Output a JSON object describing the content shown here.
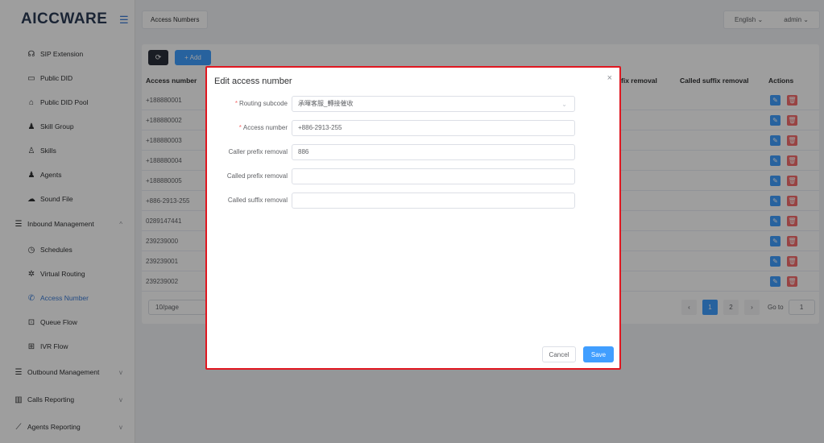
{
  "brand": {
    "logo_text": "AICCWARE",
    "toggle_icon": "menu-fold-icon"
  },
  "sidebar": {
    "items": [
      {
        "label": "SIP Extension",
        "icon": "headset-icon",
        "glyph": "☊"
      },
      {
        "label": "Public DID",
        "icon": "folder-icon",
        "glyph": "▭"
      },
      {
        "label": "Public DID Pool",
        "icon": "home-icon",
        "glyph": "⌂"
      },
      {
        "label": "Skill Group",
        "icon": "user-group-icon",
        "glyph": "♟"
      },
      {
        "label": "Skills",
        "icon": "user-outline-icon",
        "glyph": "♙"
      },
      {
        "label": "Agents",
        "icon": "user-icon",
        "glyph": "♟"
      },
      {
        "label": "Sound File",
        "icon": "cloud-icon",
        "glyph": "☁"
      },
      {
        "label": "Inbound Management",
        "icon": "list-icon",
        "glyph": "☰",
        "chevron": "^"
      },
      {
        "label": "Schedules",
        "icon": "clock-icon",
        "glyph": "◷"
      },
      {
        "label": "Virtual Routing",
        "icon": "gear-icon",
        "glyph": "✲"
      },
      {
        "label": "Access Number",
        "icon": "phone-icon",
        "glyph": "✆"
      },
      {
        "label": "Queue Flow",
        "icon": "upload-box-icon",
        "glyph": "⊡"
      },
      {
        "label": "IVR Flow",
        "icon": "grid-icon",
        "glyph": "⊞"
      },
      {
        "label": "Outbound Management",
        "icon": "list-icon",
        "glyph": "☰",
        "chevron": "v"
      },
      {
        "label": "Calls Reporting",
        "icon": "bar-chart-icon",
        "glyph": "▥",
        "chevron": "v"
      },
      {
        "label": "Agents Reporting",
        "icon": "line-chart-icon",
        "glyph": "⟋",
        "chevron": "v"
      }
    ]
  },
  "header": {
    "tab_label": "Access Numbers",
    "language": "English",
    "user": "admin"
  },
  "toolbar": {
    "add_label": "+ Add"
  },
  "table": {
    "headers": [
      "Access number",
      "fix removal",
      "Called suffix removal",
      "Actions"
    ],
    "rows": [
      {
        "access_number": "+188880001"
      },
      {
        "access_number": "+188880002"
      },
      {
        "access_number": "+188880003"
      },
      {
        "access_number": "+188880004"
      },
      {
        "access_number": "+188880005"
      },
      {
        "access_number": "+886-2913-255"
      },
      {
        "access_number": "0289147441"
      },
      {
        "access_number": "239239000"
      },
      {
        "access_number": "239239001"
      },
      {
        "access_number": "239239002"
      }
    ]
  },
  "pagination": {
    "page_size": "10/page",
    "pages": [
      "1",
      "2"
    ],
    "current_page": "1",
    "goto_label": "Go to",
    "goto_value": "1"
  },
  "modal": {
    "title": "Edit access number",
    "fields": [
      {
        "label": "Routing subcode",
        "required": true,
        "value": "承暉客服_轉接催收",
        "type": "select"
      },
      {
        "label": "Access number",
        "required": true,
        "value": "+886-2913-255",
        "type": "input"
      },
      {
        "label": "Caller prefix removal",
        "required": false,
        "value": "886",
        "type": "input"
      },
      {
        "label": "Called prefix removal",
        "required": false,
        "value": "",
        "type": "input"
      },
      {
        "label": "Called suffix removal",
        "required": false,
        "value": "",
        "type": "input"
      }
    ],
    "cancel_label": "Cancel",
    "save_label": "Save"
  },
  "colors": {
    "primary": "#409eff",
    "danger": "#f56c6c",
    "highlight_border": "#e0161f",
    "dark_button": "#2a2f3a"
  }
}
